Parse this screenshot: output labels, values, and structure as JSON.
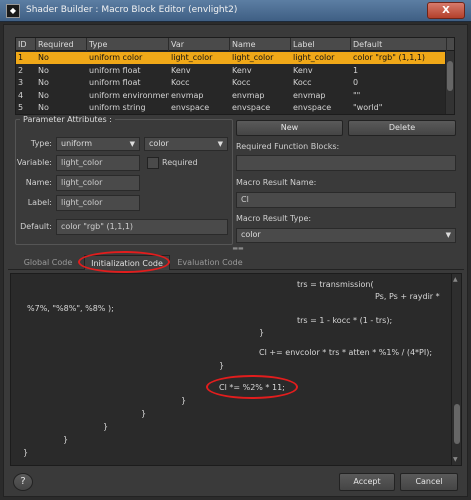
{
  "window": {
    "title": "Shader Builder : Macro Block Editor (envlight2)",
    "close_label": "X"
  },
  "table": {
    "columns": [
      "ID",
      "Required",
      "Type",
      "Var",
      "Name",
      "Label",
      "Default"
    ],
    "rows": [
      {
        "id": "1",
        "required": "No",
        "type": "uniform color",
        "var": "light_color",
        "name": "light_color",
        "label": "light_color",
        "default": "color \"rgb\" (1,1,1)"
      },
      {
        "id": "2",
        "required": "No",
        "type": "uniform float",
        "var": "Kenv",
        "name": "Kenv",
        "label": "Kenv",
        "default": "1"
      },
      {
        "id": "3",
        "required": "No",
        "type": "uniform float",
        "var": "Kocc",
        "name": "Kocc",
        "label": "Kocc",
        "default": "0"
      },
      {
        "id": "4",
        "required": "No",
        "type": "uniform environment",
        "var": "envmap",
        "name": "envmap",
        "label": "envmap",
        "default": "\"\""
      },
      {
        "id": "5",
        "required": "No",
        "type": "uniform string",
        "var": "envspace",
        "name": "envspace",
        "label": "envspace",
        "default": "\"world\""
      }
    ],
    "selected_index": 0
  },
  "params": {
    "title": "Parameter Attributes :",
    "type_label": "Type:",
    "type_value": "uniform",
    "type2_value": "color",
    "variable_label": "Variable:",
    "variable_value": "light_color",
    "required_label": "Required",
    "name_label": "Name:",
    "name_value": "light_color",
    "label_label": "Label:",
    "label_value": "light_color",
    "default_label": "Default:",
    "default_value": "color \"rgb\" (1,1,1)"
  },
  "right": {
    "new_label": "New",
    "delete_label": "Delete",
    "required_blocks_label": "Required Function Blocks:",
    "macro_result_name_label": "Macro Result Name:",
    "macro_result_name_value": "Cl",
    "macro_result_type_label": "Macro Result Type:",
    "macro_result_type_value": "color"
  },
  "tabs": [
    "Global Code",
    "Initialization Code",
    "Evaluation Code"
  ],
  "active_tab": 1,
  "code_lines": [
    "trs = transmission(",
    "Ps, Ps + raydir *",
    "%7%, \"%8%\", %8% );",
    "trs = 1 - kocc * (1 - trs);",
    "}",
    "Cl += envcolor * trs * atten * %1% / (4*PI);",
    "}",
    "Cl *= %2% * 11;",
    "}",
    "}",
    "}",
    "}",
    "}"
  ],
  "footer": {
    "help_label": "?",
    "accept_label": "Accept",
    "cancel_label": "Cancel"
  },
  "colors": {
    "selection": "#f0a818",
    "annotation": "#e21d1d"
  }
}
